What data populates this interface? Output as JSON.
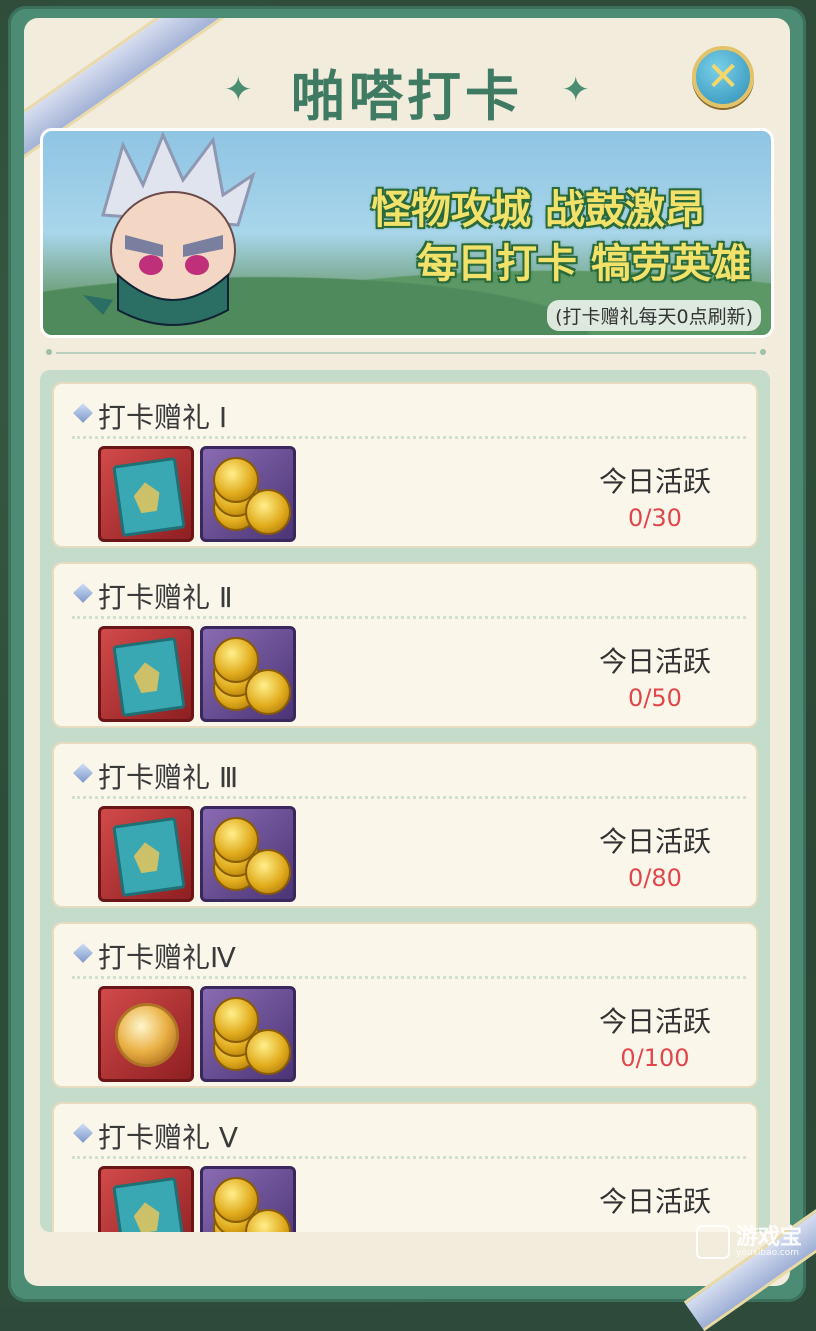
{
  "header": {
    "title": "啪嗒打卡",
    "close_icon": "close-icon"
  },
  "banner": {
    "slogan_line1": "怪物攻城 战鼓激昂",
    "slogan_line2": "每日打卡 犒劳英雄",
    "refresh_note": "(打卡赠礼每天0点刷新)"
  },
  "cards": [
    {
      "title": "打卡赠礼 Ⅰ",
      "rewards": [
        "scroll-icon",
        "gold-coins-icon"
      ],
      "active_label": "今日活跃",
      "active_value": "0/30"
    },
    {
      "title": "打卡赠礼 Ⅱ",
      "rewards": [
        "scroll-icon",
        "gold-coins-icon"
      ],
      "active_label": "今日活跃",
      "active_value": "0/50"
    },
    {
      "title": "打卡赠礼 Ⅲ",
      "rewards": [
        "scroll-icon",
        "gold-coins-icon"
      ],
      "active_label": "今日活跃",
      "active_value": "0/80"
    },
    {
      "title": "打卡赠礼Ⅳ",
      "rewards": [
        "orb-icon",
        "gold-coins-icon"
      ],
      "active_label": "今日活跃",
      "active_value": "0/100"
    },
    {
      "title": "打卡赠礼 Ⅴ",
      "rewards": [
        "scroll-icon",
        "gold-coins-icon"
      ],
      "active_label": "今日活跃",
      "active_value": ""
    }
  ],
  "watermark": {
    "text": "游戏宝",
    "sub": "youxibao.com"
  },
  "colors": {
    "title_green": "#3f7a63",
    "value_red": "#e0474c",
    "frame_green": "#4d8c74"
  }
}
